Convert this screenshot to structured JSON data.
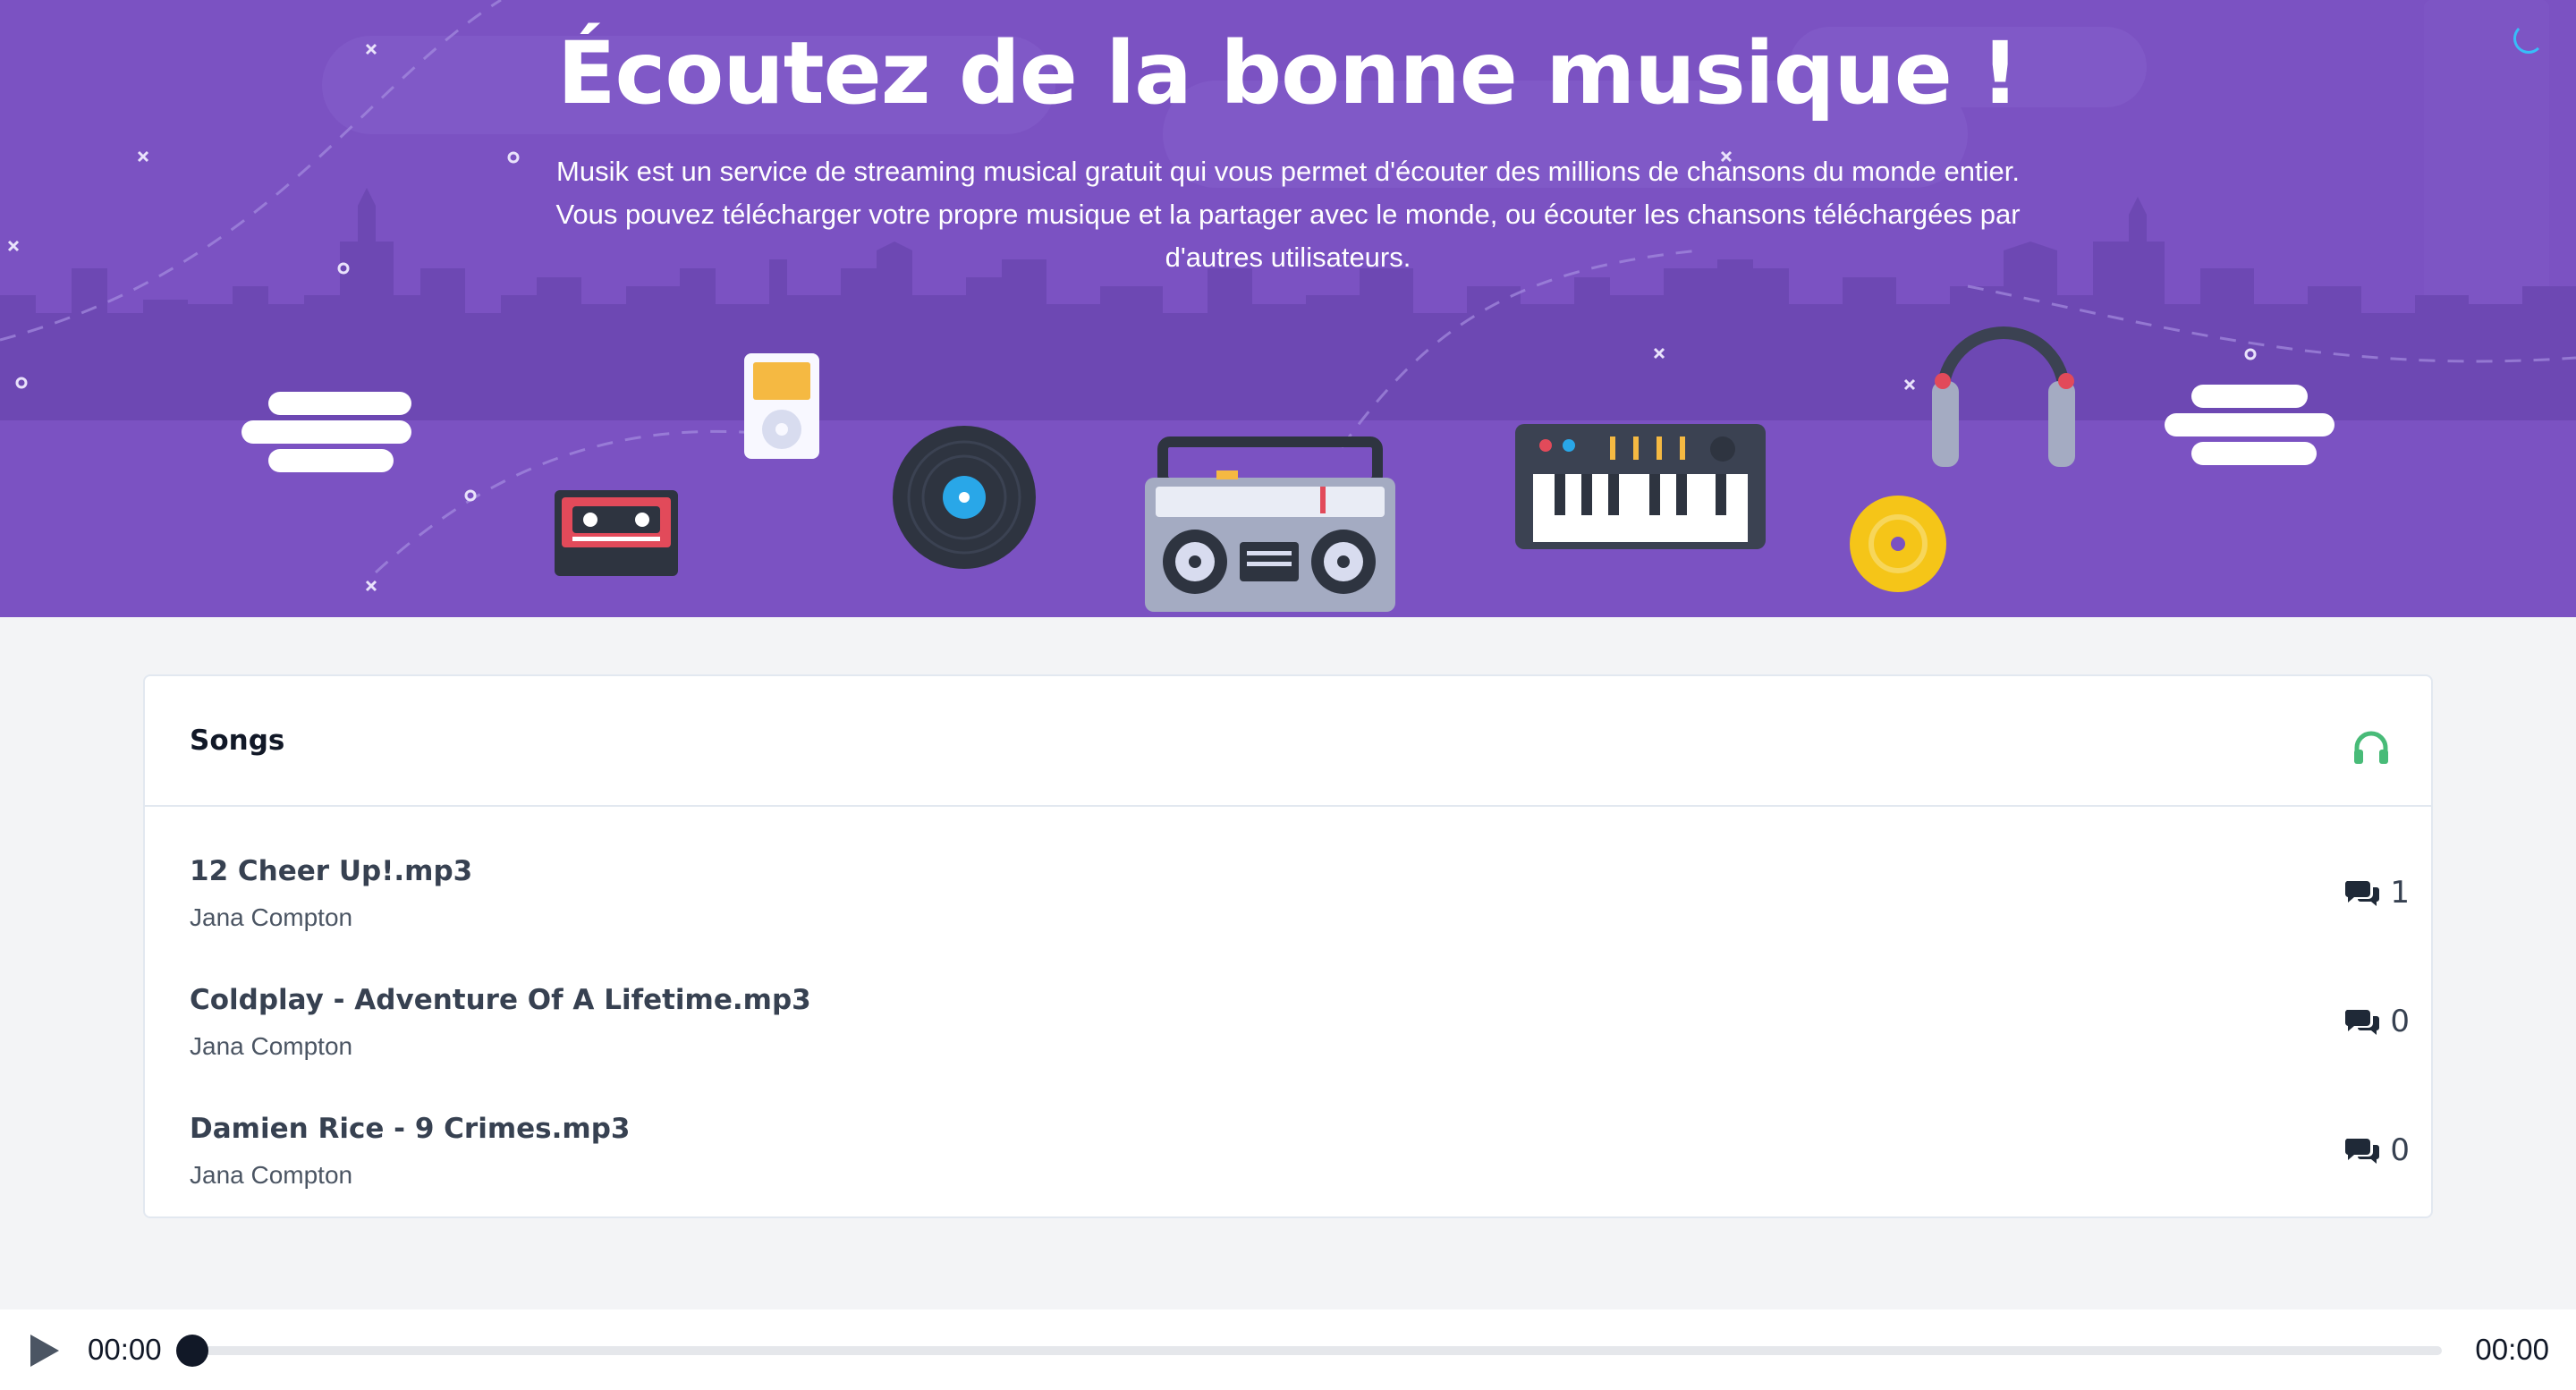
{
  "hero": {
    "title": "Écoutez de la bonne musique !",
    "description": "Musik est un service de streaming musical gratuit qui vous permet d'écouter des millions de chansons du monde entier. Vous pouvez télécharger votre propre musique et la partager avec le monde, ou écouter les chansons téléchargées par d'autres utilisateurs."
  },
  "songs": {
    "title": "Songs",
    "header_icon": "headphones-icon",
    "items": [
      {
        "title": "12 Cheer Up!.mp3",
        "artist": "Jana Compton",
        "comments": "1"
      },
      {
        "title": "Coldplay - Adventure Of A Lifetime.mp3",
        "artist": "Jana Compton",
        "comments": "0"
      },
      {
        "title": "Damien Rice - 9 Crimes.mp3",
        "artist": "Jana Compton",
        "comments": "0"
      }
    ]
  },
  "player": {
    "current_time": "00:00",
    "total_time": "00:00",
    "progress": 0
  },
  "colors": {
    "hero_bg": "#7b52c2",
    "accent_green": "#48bb78",
    "page_bg": "#f3f4f6"
  }
}
